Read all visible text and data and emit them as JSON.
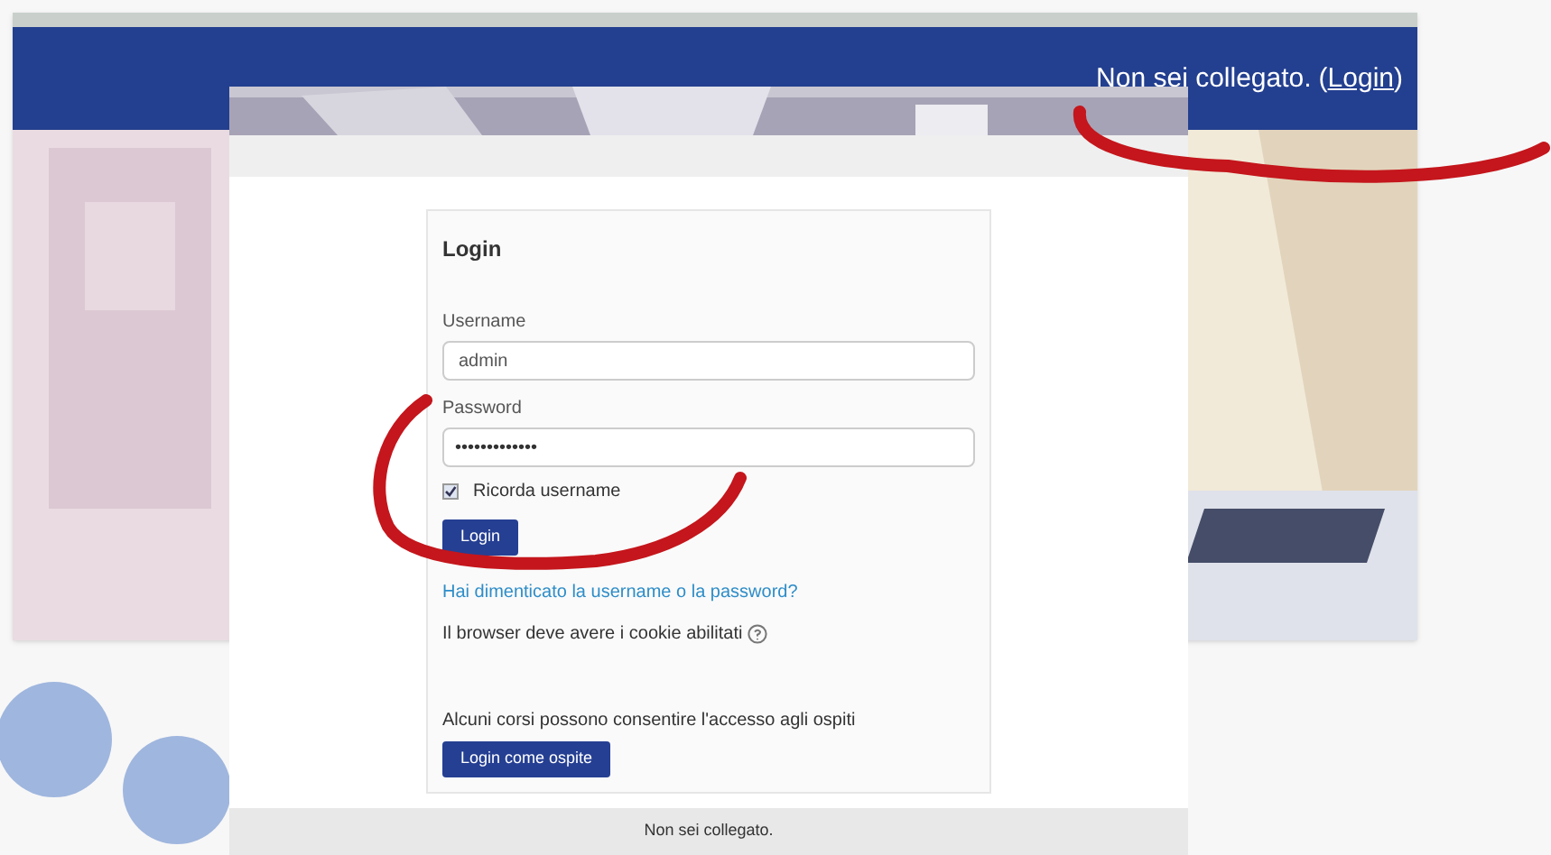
{
  "back_page": {
    "header_text": "Non sei collegato.",
    "link_open": "(",
    "header_link": "Login",
    "link_close": ")"
  },
  "login_page": {
    "card_title": "Login",
    "username": {
      "label": "Username",
      "value": "admin"
    },
    "password": {
      "label": "Password",
      "value": "•••••••••••••"
    },
    "remember": {
      "label": "Ricorda username",
      "checked": true
    },
    "login_button": "Login",
    "forgot_link": "Hai dimenticato la username o la password?",
    "cookie_note": "Il browser deve avere i cookie abilitati",
    "guest_note": "Alcuni corsi possono consentire l'accesso agli ospiti",
    "guest_button": "Login come ospite",
    "footer": "Non sei collegato."
  }
}
